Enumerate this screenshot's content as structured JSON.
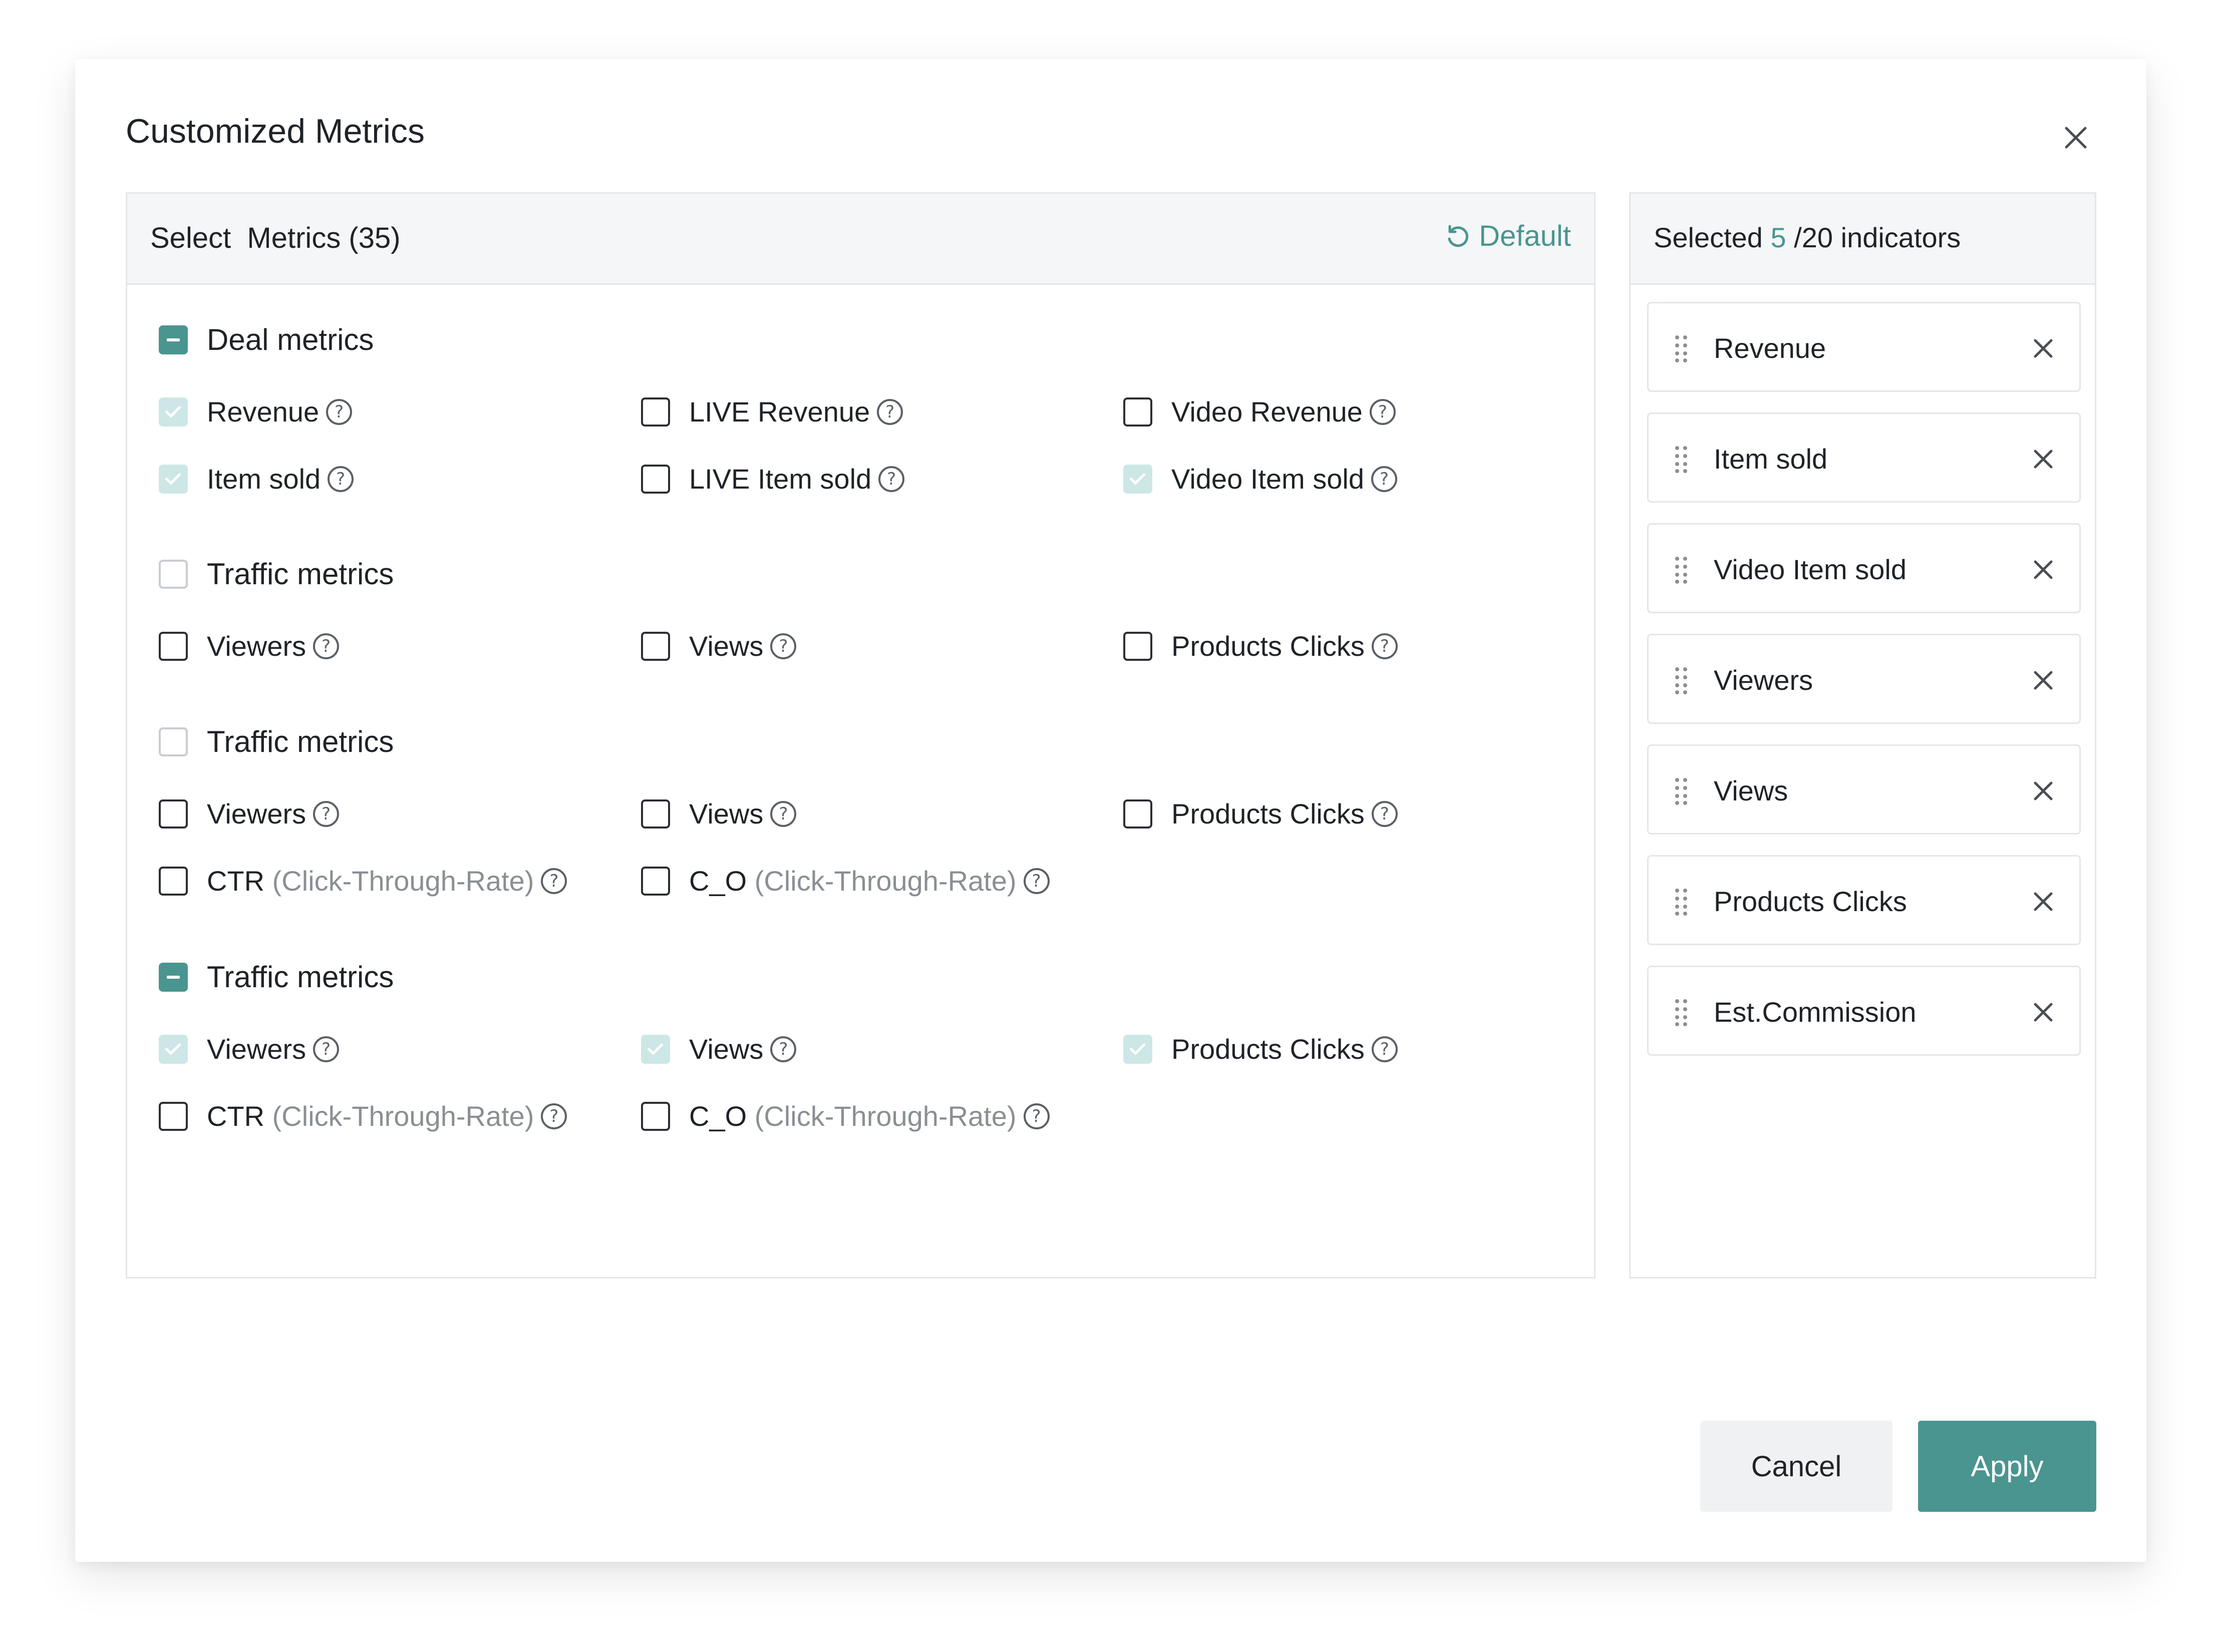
{
  "dialog": {
    "title": "Customized Metrics",
    "close_icon": "close-icon"
  },
  "left": {
    "header": "Select  Metrics (35)",
    "default_label": "Default",
    "default_icon": "reset-icon",
    "groups": [
      {
        "label": "Deal metrics",
        "state": "indeterminate",
        "items": [
          {
            "label": "Revenue",
            "sub": "",
            "checked": true
          },
          {
            "label": "LIVE Revenue",
            "sub": "",
            "checked": false
          },
          {
            "label": "Video Revenue",
            "sub": "",
            "checked": false
          },
          {
            "label": "Item sold",
            "sub": "",
            "checked": true
          },
          {
            "label": "LIVE Item sold",
            "sub": "",
            "checked": false
          },
          {
            "label": "Video Item sold",
            "sub": "",
            "checked": true
          }
        ]
      },
      {
        "label": "Traffic metrics",
        "state": "unchecked",
        "items": [
          {
            "label": "Viewers",
            "sub": "",
            "checked": false
          },
          {
            "label": "Views",
            "sub": "",
            "checked": false
          },
          {
            "label": "Products Clicks",
            "sub": "",
            "checked": false
          }
        ]
      },
      {
        "label": "Traffic metrics",
        "state": "unchecked",
        "items": [
          {
            "label": "Viewers",
            "sub": "",
            "checked": false
          },
          {
            "label": "Views",
            "sub": "",
            "checked": false
          },
          {
            "label": "Products Clicks",
            "sub": "",
            "checked": false
          },
          {
            "label": "CTR",
            "sub": "(Click-Through-Rate)",
            "checked": false
          },
          {
            "label": "C_O",
            "sub": "(Click-Through-Rate)",
            "checked": false
          }
        ]
      },
      {
        "label": "Traffic metrics",
        "state": "indeterminate",
        "items": [
          {
            "label": "Viewers",
            "sub": "",
            "checked": true
          },
          {
            "label": "Views",
            "sub": "",
            "checked": true
          },
          {
            "label": "Products Clicks",
            "sub": "",
            "checked": true
          },
          {
            "label": "CTR",
            "sub": "(Click-Through-Rate)",
            "checked": false
          },
          {
            "label": "C_O",
            "sub": "(Click-Through-Rate)",
            "checked": false
          }
        ]
      }
    ]
  },
  "right": {
    "selected_prefix": "Selected",
    "selected_count": "5",
    "selected_suffix": "/20 indicators",
    "items": [
      {
        "label": "Revenue"
      },
      {
        "label": "Item sold"
      },
      {
        "label": "Video Item sold"
      },
      {
        "label": "Viewers"
      },
      {
        "label": "Views"
      },
      {
        "label": "Products Clicks"
      },
      {
        "label": "Est.Commission"
      }
    ]
  },
  "footer": {
    "cancel_label": "Cancel",
    "apply_label": "Apply"
  },
  "colors": {
    "accent": "#4a9590",
    "checked_light": "#cde7e6",
    "border": "#e4e6e8"
  }
}
